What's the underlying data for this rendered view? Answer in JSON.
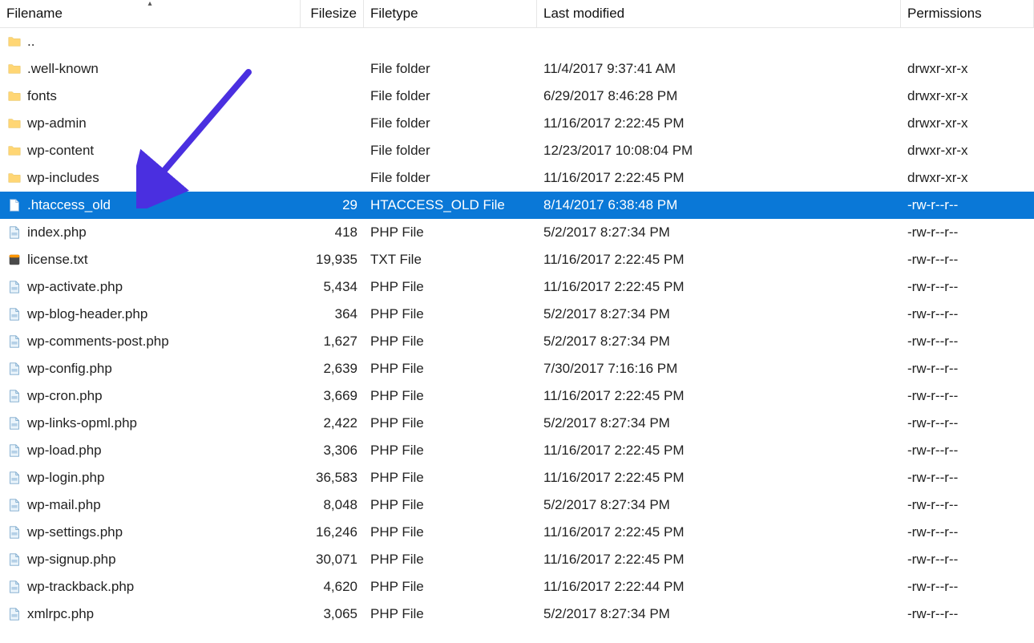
{
  "columns": {
    "name": "Filename",
    "size": "Filesize",
    "type": "Filetype",
    "mod": "Last modified",
    "perm": "Permissions"
  },
  "sort_column": "name",
  "sort_dir": "asc",
  "selected_index": 6,
  "rows": [
    {
      "icon": "folder",
      "name": "..",
      "size": "",
      "type": "",
      "mod": "",
      "perm": ""
    },
    {
      "icon": "folder",
      "name": ".well-known",
      "size": "",
      "type": "File folder",
      "mod": "11/4/2017 9:37:41 AM",
      "perm": "drwxr-xr-x"
    },
    {
      "icon": "folder",
      "name": "fonts",
      "size": "",
      "type": "File folder",
      "mod": "6/29/2017 8:46:28 PM",
      "perm": "drwxr-xr-x"
    },
    {
      "icon": "folder",
      "name": "wp-admin",
      "size": "",
      "type": "File folder",
      "mod": "11/16/2017 2:22:45 PM",
      "perm": "drwxr-xr-x"
    },
    {
      "icon": "folder",
      "name": "wp-content",
      "size": "",
      "type": "File folder",
      "mod": "12/23/2017 10:08:04 PM",
      "perm": "drwxr-xr-x"
    },
    {
      "icon": "folder",
      "name": "wp-includes",
      "size": "",
      "type": "File folder",
      "mod": "11/16/2017 2:22:45 PM",
      "perm": "drwxr-xr-x"
    },
    {
      "icon": "file",
      "name": ".htaccess_old",
      "size": "29",
      "type": "HTACCESS_OLD File",
      "mod": "8/14/2017 6:38:48 PM",
      "perm": "-rw-r--r--"
    },
    {
      "icon": "php",
      "name": "index.php",
      "size": "418",
      "type": "PHP File",
      "mod": "5/2/2017 8:27:34 PM",
      "perm": "-rw-r--r--"
    },
    {
      "icon": "txt",
      "name": "license.txt",
      "size": "19,935",
      "type": "TXT File",
      "mod": "11/16/2017 2:22:45 PM",
      "perm": "-rw-r--r--"
    },
    {
      "icon": "php",
      "name": "wp-activate.php",
      "size": "5,434",
      "type": "PHP File",
      "mod": "11/16/2017 2:22:45 PM",
      "perm": "-rw-r--r--"
    },
    {
      "icon": "php",
      "name": "wp-blog-header.php",
      "size": "364",
      "type": "PHP File",
      "mod": "5/2/2017 8:27:34 PM",
      "perm": "-rw-r--r--"
    },
    {
      "icon": "php",
      "name": "wp-comments-post.php",
      "size": "1,627",
      "type": "PHP File",
      "mod": "5/2/2017 8:27:34 PM",
      "perm": "-rw-r--r--"
    },
    {
      "icon": "php",
      "name": "wp-config.php",
      "size": "2,639",
      "type": "PHP File",
      "mod": "7/30/2017 7:16:16 PM",
      "perm": "-rw-r--r--"
    },
    {
      "icon": "php",
      "name": "wp-cron.php",
      "size": "3,669",
      "type": "PHP File",
      "mod": "11/16/2017 2:22:45 PM",
      "perm": "-rw-r--r--"
    },
    {
      "icon": "php",
      "name": "wp-links-opml.php",
      "size": "2,422",
      "type": "PHP File",
      "mod": "5/2/2017 8:27:34 PM",
      "perm": "-rw-r--r--"
    },
    {
      "icon": "php",
      "name": "wp-load.php",
      "size": "3,306",
      "type": "PHP File",
      "mod": "11/16/2017 2:22:45 PM",
      "perm": "-rw-r--r--"
    },
    {
      "icon": "php",
      "name": "wp-login.php",
      "size": "36,583",
      "type": "PHP File",
      "mod": "11/16/2017 2:22:45 PM",
      "perm": "-rw-r--r--"
    },
    {
      "icon": "php",
      "name": "wp-mail.php",
      "size": "8,048",
      "type": "PHP File",
      "mod": "5/2/2017 8:27:34 PM",
      "perm": "-rw-r--r--"
    },
    {
      "icon": "php",
      "name": "wp-settings.php",
      "size": "16,246",
      "type": "PHP File",
      "mod": "11/16/2017 2:22:45 PM",
      "perm": "-rw-r--r--"
    },
    {
      "icon": "php",
      "name": "wp-signup.php",
      "size": "30,071",
      "type": "PHP File",
      "mod": "11/16/2017 2:22:45 PM",
      "perm": "-rw-r--r--"
    },
    {
      "icon": "php",
      "name": "wp-trackback.php",
      "size": "4,620",
      "type": "PHP File",
      "mod": "11/16/2017 2:22:44 PM",
      "perm": "-rw-r--r--"
    },
    {
      "icon": "php",
      "name": "xmlrpc.php",
      "size": "3,065",
      "type": "PHP File",
      "mod": "5/2/2017 8:27:34 PM",
      "perm": "-rw-r--r--"
    }
  ]
}
